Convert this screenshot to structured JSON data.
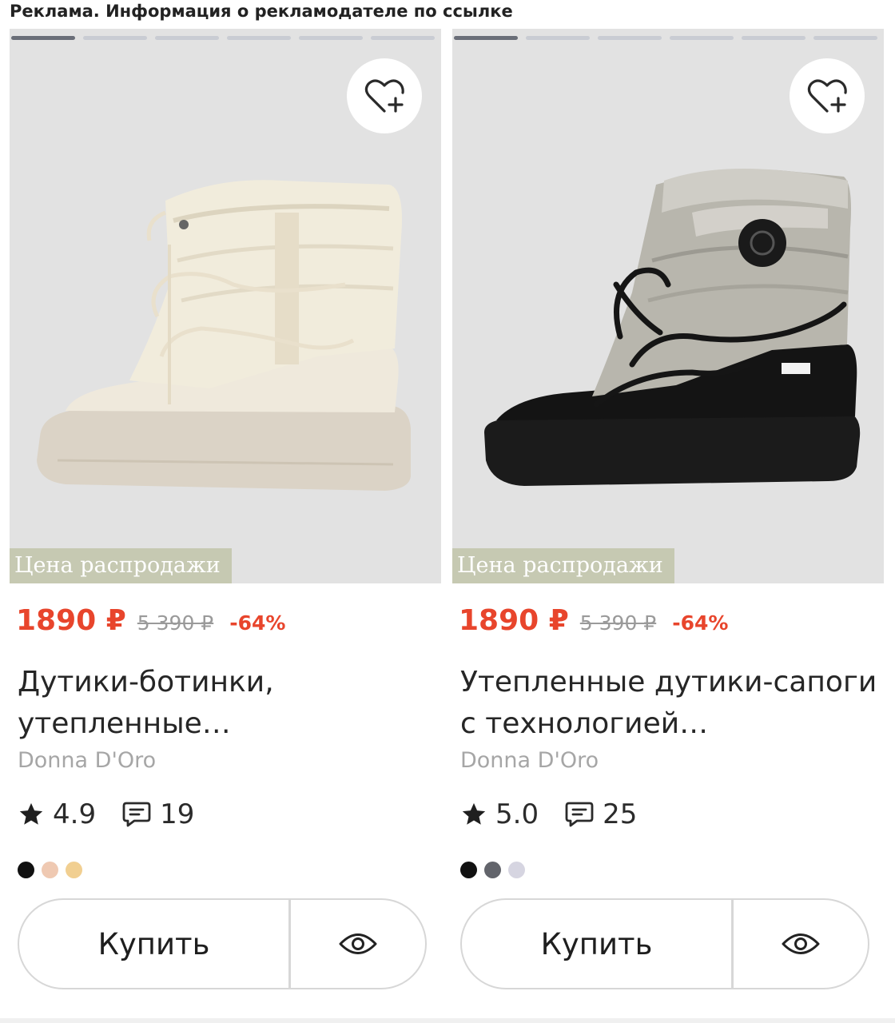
{
  "ad_notice": "Реклама. Информация о рекламодателе по ссылке",
  "colors": {
    "price": "#e8452c",
    "badge_bg": "#c6c9b2",
    "muted": "#a6a6a6",
    "border": "#d7d7d7"
  },
  "products": [
    {
      "sale_badge": "Цена распродажи",
      "price": "1890 ₽",
      "old_price": "5 390 ₽",
      "discount": "-64%",
      "title": "Дутики-ботинки, утепленные…",
      "brand": "Donna D'Oro",
      "rating": "4.9",
      "reviews": "19",
      "swatches": [
        "#111111",
        "#efc9b2",
        "#f1cf91"
      ],
      "buy_label": "Купить",
      "favorite_icon": "heart-plus-icon",
      "view_icon": "eye-icon",
      "image": "beige-puffer-boot",
      "gallery": {
        "total": 6,
        "active": 1
      }
    },
    {
      "sale_badge": "Цена распродажи",
      "price": "1890 ₽",
      "old_price": "5 390 ₽",
      "discount": "-64%",
      "title": "Утепленные дутики-сапоги с технологией…",
      "brand": "Donna D'Oro",
      "rating": "5.0",
      "reviews": "25",
      "swatches": [
        "#111111",
        "#62646b",
        "#d6d5e1"
      ],
      "buy_label": "Купить",
      "favorite_icon": "heart-plus-icon",
      "view_icon": "eye-icon",
      "image": "silver-black-moon-boot",
      "gallery": {
        "total": 6,
        "active": 1
      }
    }
  ]
}
